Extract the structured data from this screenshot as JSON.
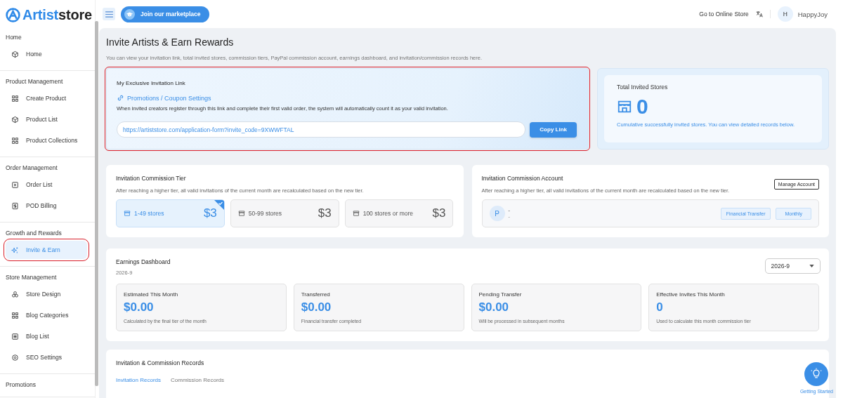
{
  "logo": {
    "accent": "Artist",
    "rest": "store"
  },
  "header": {
    "marketplace_button": "Join our marketplace",
    "store_link": "Go to Online Store",
    "user": {
      "initial": "H",
      "name": "HappyJoy"
    }
  },
  "sidebar": {
    "sections": [
      {
        "title": "Home",
        "items": [
          {
            "label": "Home",
            "selected": false,
            "highlighted": false
          }
        ]
      },
      {
        "title": "Product Management",
        "items": [
          {
            "label": "Create Product",
            "selected": false,
            "highlighted": false
          },
          {
            "label": "Product List",
            "selected": false,
            "highlighted": false
          },
          {
            "label": "Product Collections",
            "selected": false,
            "highlighted": false
          }
        ]
      },
      {
        "title": "Order Management",
        "items": [
          {
            "label": "Order List",
            "selected": false,
            "highlighted": false
          },
          {
            "label": "POD Billing",
            "selected": false,
            "highlighted": false
          }
        ]
      },
      {
        "title": "Growth and Rewards",
        "items": [
          {
            "label": "Invite & Earn",
            "selected": true,
            "highlighted": true
          }
        ]
      },
      {
        "title": "Store Management",
        "items": [
          {
            "label": "Store Design",
            "selected": false,
            "highlighted": false
          },
          {
            "label": "Blog Categories",
            "selected": false,
            "highlighted": false
          },
          {
            "label": "Blog List",
            "selected": false,
            "highlighted": false
          },
          {
            "label": "SEO Settings",
            "selected": false,
            "highlighted": false
          }
        ]
      },
      {
        "title": "Promotions"
      }
    ]
  },
  "page": {
    "title": "Invite Artists & Earn Rewards",
    "subtitle": "You can view your invitation link, total invited stores, commission tiers, PayPal commission account, earnings dashboard, and invitation/commission records here."
  },
  "invite_link": {
    "highlighted": true,
    "title": "My Exclusive Invitation Link",
    "settings_link": "Promotions / Coupon Settings",
    "description": "When invited creators register through this link and complete their first valid order, the system will automatically count it as your valid invitation.",
    "url": "https://artiststore.com/application-form?invite_code=9XWWFTAL",
    "button": "Copy Link"
  },
  "total_invited": {
    "title": "Total Invited Stores",
    "count": "0",
    "note": "Cumulative successfully invited stores. You can view detailed records below."
  },
  "commission_tier": {
    "title": "Invitation Commission Tier",
    "description": "After reaching a higher tier, all valid invitations of the current month are recalculated based on the new tier.",
    "tiers": [
      {
        "label": "1-49 stores",
        "amount": "$3",
        "selected": true
      },
      {
        "label": "50-99 stores",
        "amount": "$3",
        "selected": false
      },
      {
        "label": "100 stores or more",
        "amount": "$3",
        "selected": false
      }
    ]
  },
  "commission_account": {
    "title": "Invitation Commission Account",
    "description": "After reaching a higher tier, all valid invitations of the current month are recalculated based on the new tier.",
    "button": "Manage Account",
    "account": {
      "initial": "P",
      "name": "-",
      "detail": "-",
      "tags": [
        "Financial Transfer",
        "Monthly"
      ]
    }
  },
  "earnings": {
    "title": "Earnings Dashboard",
    "period": "2026-9",
    "month_select": "2026-9",
    "stats": [
      {
        "label": "Estimated This Month",
        "value": "$0.00",
        "note": "Calculated by the final tier of the month"
      },
      {
        "label": "Transferred",
        "value": "$0.00",
        "note": "Financial transfer completed"
      },
      {
        "label": "Pending Transfer",
        "value": "$0.00",
        "note": "Will be processed in subsequent months"
      },
      {
        "label": "Effective Invites This Month",
        "value": "0",
        "note": "Used to calculate this month commission tier"
      }
    ]
  },
  "records": {
    "title": "Invitation & Commission Records",
    "tabs": [
      {
        "label": "Invitation Records",
        "selected": true
      },
      {
        "label": "Commission Records",
        "selected": false
      }
    ]
  },
  "help_button": "Getting Started"
}
